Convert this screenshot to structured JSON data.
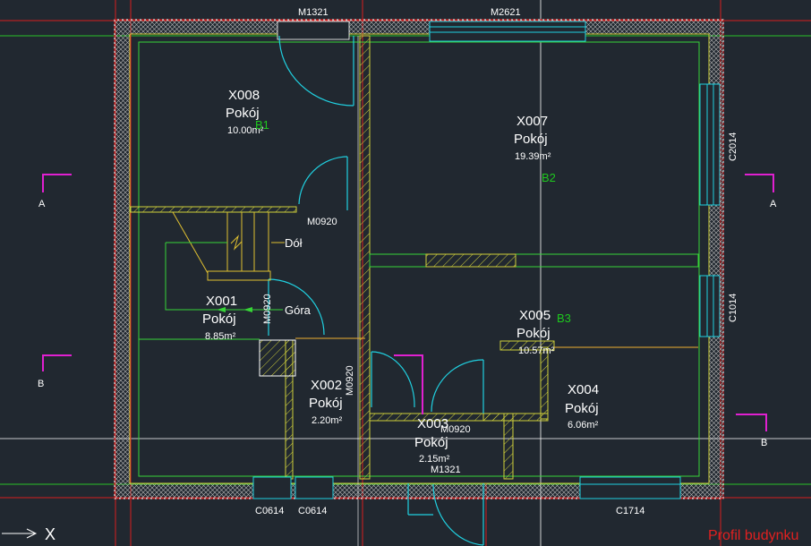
{
  "colors": {
    "background": "#212830",
    "axis_red": "#d81e1e",
    "axis_green": "#29c229",
    "wall": "#cfcf3a",
    "inner": "#37d437",
    "door": "#20d0e0",
    "section": "#e020d0",
    "stair": "#e0c030",
    "room_line": "#f0b030"
  },
  "openings": {
    "m1321_top": "M1321",
    "m2621": "M2621",
    "m0920_a": "M0920",
    "m0920_b": "M0920",
    "m0920_c": "M0920",
    "m0920_d": "M0920",
    "m1321_bottom": "M1321",
    "c2014": "C2014",
    "c1014": "C1014",
    "c0614_a": "C0614",
    "c0614_b": "C0614",
    "c1714": "C1714"
  },
  "rooms": [
    {
      "id": "X008",
      "name": "Pokój",
      "area": "10.00m²",
      "tag": "B1"
    },
    {
      "id": "X007",
      "name": "Pokój",
      "area": "19.39m²",
      "tag": "B2"
    },
    {
      "id": "X001",
      "name": "Pokój",
      "area": "8.85m²"
    },
    {
      "id": "X005",
      "name": "Pokój",
      "area": "10.57m²",
      "tag": "B3"
    },
    {
      "id": "X002",
      "name": "Pokój",
      "area": "2.20m²"
    },
    {
      "id": "X003",
      "name": "Pokój",
      "area": "2.15m²"
    },
    {
      "id": "X004",
      "name": "Pokój",
      "area": "6.06m²"
    }
  ],
  "stairs": {
    "down": "Dół",
    "up": "Góra"
  },
  "sections": {
    "a_left": "A",
    "a_right": "A",
    "b_left": "B",
    "b_right": "B"
  },
  "ucs": {
    "x_label": "X"
  },
  "footer": {
    "title": "Profil budynku"
  }
}
